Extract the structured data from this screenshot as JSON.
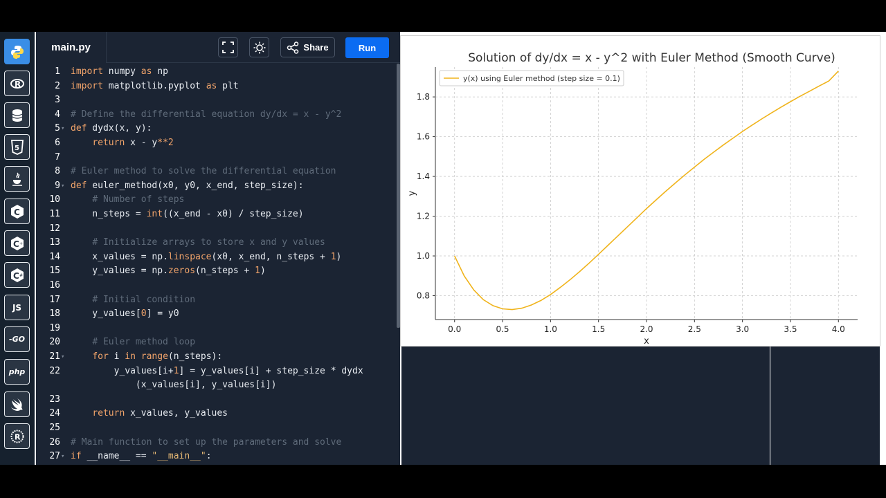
{
  "sidebar": {
    "items": [
      {
        "name": "python-icon",
        "label": ""
      },
      {
        "name": "r-icon",
        "label": "R"
      },
      {
        "name": "sql-icon",
        "label": ""
      },
      {
        "name": "html5-icon",
        "label": "5"
      },
      {
        "name": "java-icon",
        "label": ""
      },
      {
        "name": "c-icon",
        "label": "C"
      },
      {
        "name": "cpp-icon",
        "label": "C"
      },
      {
        "name": "csharp-icon",
        "label": "C"
      },
      {
        "name": "javascript-icon",
        "label": "JS"
      },
      {
        "name": "go-icon",
        "label": "-GO"
      },
      {
        "name": "php-icon",
        "label": "php"
      },
      {
        "name": "swift-icon",
        "label": ""
      },
      {
        "name": "rust-icon",
        "label": "R"
      }
    ]
  },
  "editor": {
    "tab_label": "main.py",
    "share_label": "Share",
    "run_label": "Run",
    "lines": [
      {
        "n": "1",
        "fold": false,
        "segs": [
          [
            "kw",
            "import"
          ],
          [
            "t",
            " numpy "
          ],
          [
            "kw",
            "as"
          ],
          [
            "t",
            " np"
          ]
        ]
      },
      {
        "n": "2",
        "fold": false,
        "segs": [
          [
            "kw",
            "import"
          ],
          [
            "t",
            " matplotlib.pyplot "
          ],
          [
            "kw",
            "as"
          ],
          [
            "t",
            " plt"
          ]
        ]
      },
      {
        "n": "3",
        "fold": false,
        "segs": []
      },
      {
        "n": "4",
        "fold": false,
        "segs": [
          [
            "cm",
            "# Define the differential equation dy/dx = x - y^2"
          ]
        ]
      },
      {
        "n": "5",
        "fold": true,
        "segs": [
          [
            "kw",
            "def"
          ],
          [
            "t",
            " dydx(x, y):"
          ]
        ]
      },
      {
        "n": "6",
        "fold": false,
        "segs": [
          [
            "t",
            "    "
          ],
          [
            "kw",
            "return"
          ],
          [
            "t",
            " x - y"
          ],
          [
            "kw",
            "**"
          ],
          [
            "num",
            "2"
          ]
        ]
      },
      {
        "n": "7",
        "fold": false,
        "segs": []
      },
      {
        "n": "8",
        "fold": false,
        "segs": [
          [
            "cm",
            "# Euler method to solve the differential equation"
          ]
        ]
      },
      {
        "n": "9",
        "fold": true,
        "segs": [
          [
            "kw",
            "def"
          ],
          [
            "t",
            " euler_method(x0, y0, x_end, step_size):"
          ]
        ]
      },
      {
        "n": "10",
        "fold": false,
        "segs": [
          [
            "t",
            "    "
          ],
          [
            "cm",
            "# Number of steps"
          ]
        ]
      },
      {
        "n": "11",
        "fold": false,
        "segs": [
          [
            "t",
            "    n_steps = "
          ],
          [
            "kw",
            "int"
          ],
          [
            "t",
            "((x_end - x0) / step_size)"
          ]
        ]
      },
      {
        "n": "12",
        "fold": false,
        "segs": []
      },
      {
        "n": "13",
        "fold": false,
        "segs": [
          [
            "t",
            "    "
          ],
          [
            "cm",
            "# Initialize arrays to store x and y values"
          ]
        ]
      },
      {
        "n": "14",
        "fold": false,
        "segs": [
          [
            "t",
            "    x_values = np."
          ],
          [
            "kw",
            "linspace"
          ],
          [
            "t",
            "(x0, x_end, n_steps + "
          ],
          [
            "num",
            "1"
          ],
          [
            "t",
            ")"
          ]
        ]
      },
      {
        "n": "15",
        "fold": false,
        "segs": [
          [
            "t",
            "    y_values = np."
          ],
          [
            "kw",
            "zeros"
          ],
          [
            "t",
            "(n_steps + "
          ],
          [
            "num",
            "1"
          ],
          [
            "t",
            ")"
          ]
        ]
      },
      {
        "n": "16",
        "fold": false,
        "segs": []
      },
      {
        "n": "17",
        "fold": false,
        "segs": [
          [
            "t",
            "    "
          ],
          [
            "cm",
            "# Initial condition"
          ]
        ]
      },
      {
        "n": "18",
        "fold": false,
        "segs": [
          [
            "t",
            "    y_values["
          ],
          [
            "num",
            "0"
          ],
          [
            "t",
            "] = y0"
          ]
        ]
      },
      {
        "n": "19",
        "fold": false,
        "segs": []
      },
      {
        "n": "20",
        "fold": false,
        "segs": [
          [
            "t",
            "    "
          ],
          [
            "cm",
            "# Euler method loop"
          ]
        ]
      },
      {
        "n": "21",
        "fold": true,
        "segs": [
          [
            "t",
            "    "
          ],
          [
            "kw",
            "for"
          ],
          [
            "t",
            " i "
          ],
          [
            "kw",
            "in"
          ],
          [
            "t",
            " "
          ],
          [
            "kw",
            "range"
          ],
          [
            "t",
            "(n_steps):"
          ]
        ]
      },
      {
        "n": "22",
        "fold": false,
        "segs": [
          [
            "t",
            "        y_values[i+"
          ],
          [
            "num",
            "1"
          ],
          [
            "t",
            "] = y_values[i] + step_size * dydx"
          ]
        ]
      },
      {
        "n": "",
        "fold": false,
        "segs": [
          [
            "t",
            "            (x_values[i], y_values[i])"
          ]
        ]
      },
      {
        "n": "23",
        "fold": false,
        "segs": []
      },
      {
        "n": "24",
        "fold": false,
        "segs": [
          [
            "t",
            "    "
          ],
          [
            "kw",
            "return"
          ],
          [
            "t",
            " x_values, y_values"
          ]
        ]
      },
      {
        "n": "25",
        "fold": false,
        "segs": []
      },
      {
        "n": "26",
        "fold": false,
        "segs": [
          [
            "cm",
            "# Main function to set up the parameters and solve"
          ]
        ]
      },
      {
        "n": "27",
        "fold": true,
        "segs": [
          [
            "kw",
            "if"
          ],
          [
            "t",
            " __name__ == "
          ],
          [
            "str",
            "\"__main__\""
          ],
          [
            "t",
            ":"
          ]
        ]
      }
    ]
  },
  "colors": {
    "line": "#f0b41c",
    "run_button": "#0b6cf2",
    "active_lang": "#3a8ee6"
  },
  "chart_data": {
    "type": "line",
    "title": "Solution of dy/dx = x - y^2 with Euler Method (Smooth Curve)",
    "xlabel": "x",
    "ylabel": "y",
    "xlim": [
      -0.2,
      4.2
    ],
    "ylim": [
      0.68,
      1.95
    ],
    "xticks": [
      "0.0",
      "0.5",
      "1.0",
      "1.5",
      "2.0",
      "2.5",
      "3.0",
      "3.5",
      "4.0"
    ],
    "yticks": [
      "0.8",
      "1.0",
      "1.2",
      "1.4",
      "1.6",
      "1.8"
    ],
    "legend_position": "top-left",
    "grid": true,
    "series": [
      {
        "name": "y(x) using Euler method (step size = 0.1)",
        "x": [
          0.0,
          0.1,
          0.2,
          0.3,
          0.4,
          0.5,
          0.6,
          0.7,
          0.8,
          0.9,
          1.0,
          1.1,
          1.2,
          1.3,
          1.4,
          1.5,
          1.6,
          1.7,
          1.8,
          1.9,
          2.0,
          2.1,
          2.2,
          2.3,
          2.4,
          2.5,
          2.6,
          2.7,
          2.8,
          2.9,
          3.0,
          3.1,
          3.2,
          3.3,
          3.4,
          3.5,
          3.6,
          3.7,
          3.8,
          3.9,
          4.0
        ],
        "y": [
          1.0,
          0.9,
          0.829,
          0.78,
          0.75,
          0.734,
          0.73,
          0.737,
          0.753,
          0.776,
          0.806,
          0.841,
          0.879,
          0.92,
          0.963,
          1.008,
          1.054,
          1.1,
          1.146,
          1.192,
          1.238,
          1.282,
          1.325,
          1.367,
          1.408,
          1.447,
          1.486,
          1.522,
          1.558,
          1.592,
          1.626,
          1.658,
          1.689,
          1.719,
          1.748,
          1.776,
          1.803,
          1.829,
          1.855,
          1.88,
          1.93
        ]
      }
    ]
  }
}
